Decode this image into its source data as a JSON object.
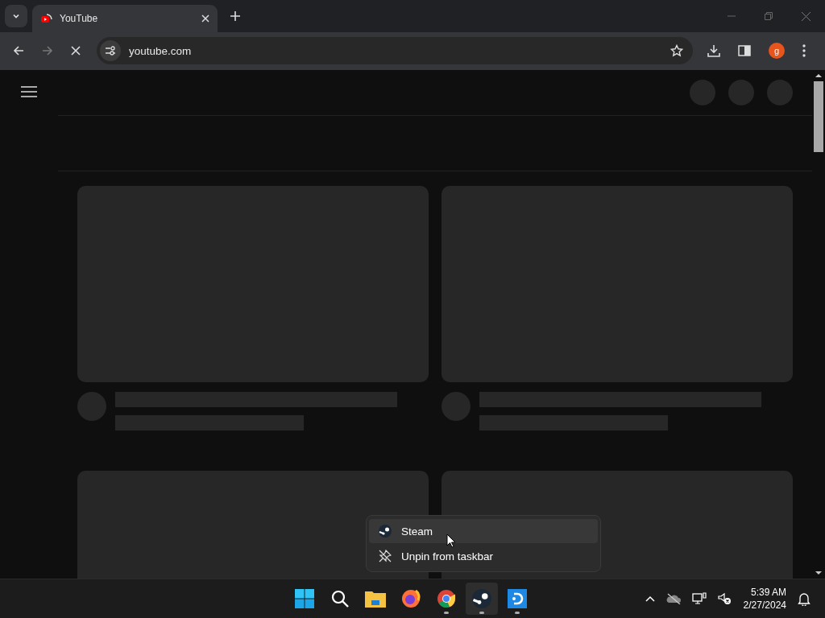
{
  "browser": {
    "tabs": [
      {
        "title": "YouTube",
        "selected": true
      }
    ],
    "loading": true,
    "address": "youtube.com",
    "profile_initial": "g"
  },
  "page": {
    "cards": [
      {
        "kind": "skeleton"
      },
      {
        "kind": "skeleton"
      },
      {
        "kind": "thumbnail"
      },
      {
        "kind": "thumbnail"
      }
    ]
  },
  "context_menu": {
    "items": [
      {
        "kind": "app",
        "label": "Steam",
        "selected": true
      },
      {
        "kind": "unpin",
        "label": "Unpin from taskbar",
        "selected": false
      }
    ]
  },
  "taskbar": {
    "apps": [
      {
        "kind": "start",
        "running": false,
        "active": false
      },
      {
        "kind": "search",
        "running": false,
        "active": false
      },
      {
        "kind": "folder",
        "running": false,
        "active": false
      },
      {
        "kind": "firefox",
        "running": false,
        "active": false
      },
      {
        "kind": "chrome",
        "running": true,
        "active": false
      },
      {
        "kind": "steam",
        "running": true,
        "active": true
      },
      {
        "kind": "dapp",
        "running": true,
        "active": false
      }
    ],
    "clock": {
      "time": "5:39 AM",
      "date": "2/27/2024"
    }
  }
}
